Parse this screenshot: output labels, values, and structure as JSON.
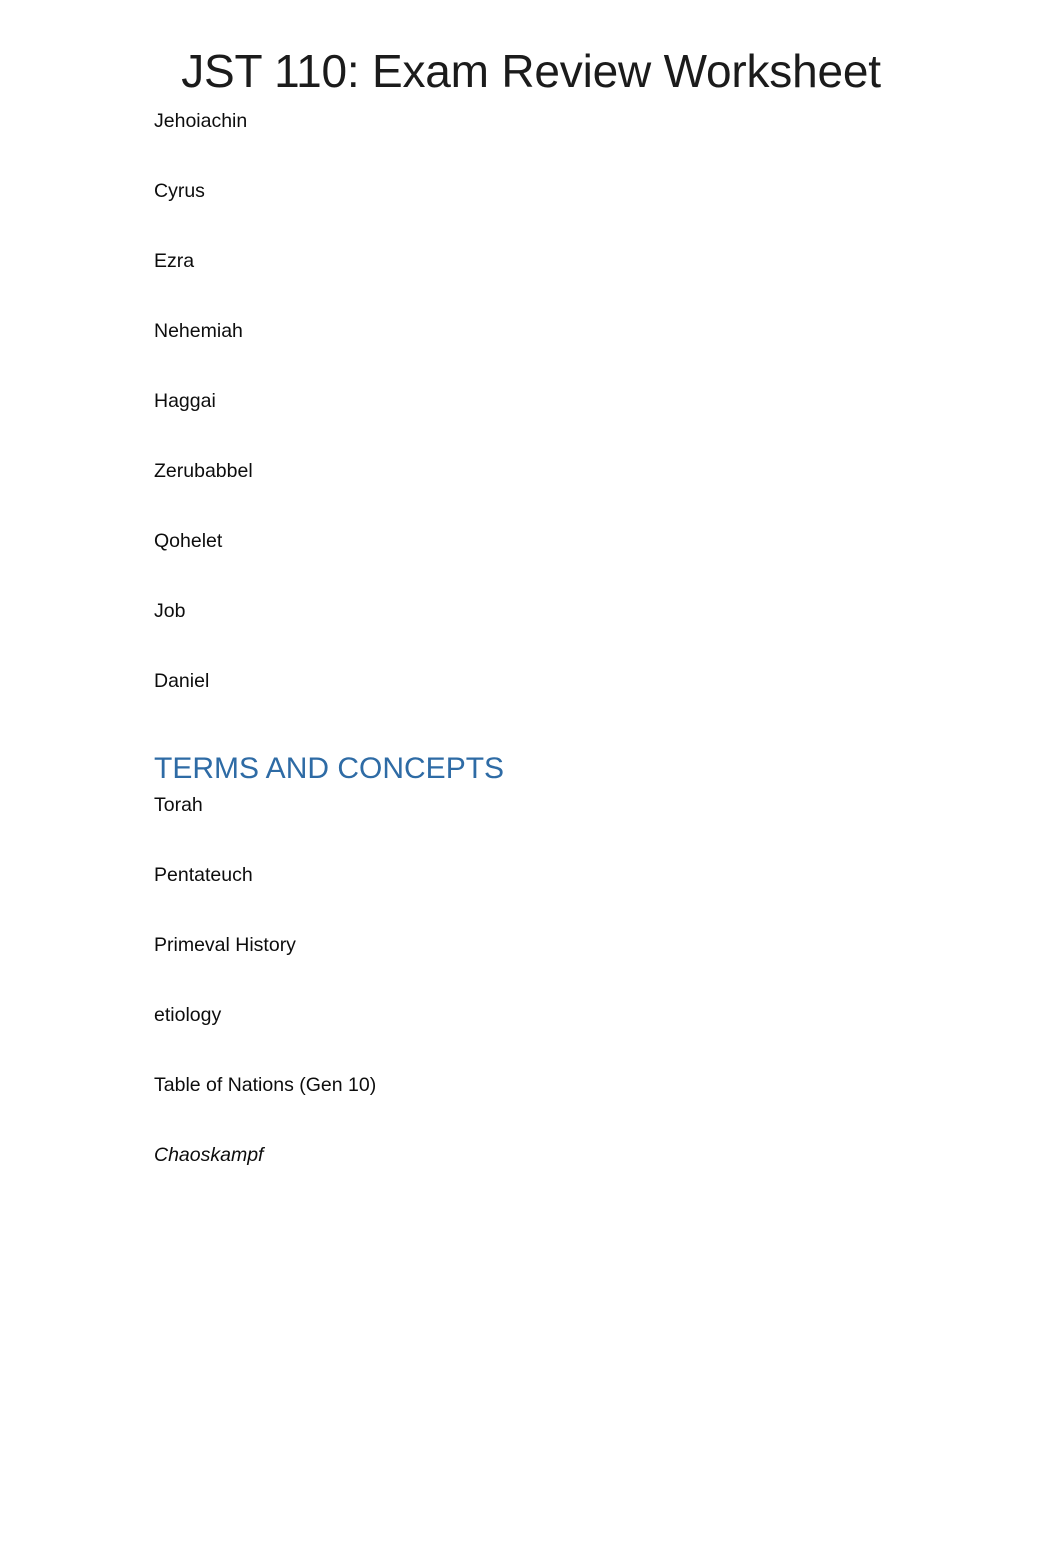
{
  "document": {
    "title": "JST 110: Exam Review Worksheet",
    "title_color": "#1b1b1b",
    "background_color": "#ffffff",
    "body_text_color": "#0d0d0d"
  },
  "people_section": {
    "items": [
      {
        "label": "Jehoiachin",
        "style": "normal"
      },
      {
        "label": "Cyrus",
        "style": "normal"
      },
      {
        "label": "Ezra",
        "style": "normal"
      },
      {
        "label": "Nehemiah",
        "style": "normal"
      },
      {
        "label": "Haggai",
        "style": "normal"
      },
      {
        "label": "Zerubabbel",
        "style": "normal"
      },
      {
        "label": "Qohelet",
        "style": "normal"
      },
      {
        "label": "Job",
        "style": "normal"
      },
      {
        "label": "Daniel",
        "style": "normal"
      }
    ]
  },
  "terms_section": {
    "heading": "TERMS AND CONCEPTS",
    "heading_color": "#2e6ba5",
    "items": [
      {
        "label": "Torah",
        "style": "normal"
      },
      {
        "label": "Pentateuch",
        "style": "normal"
      },
      {
        "label": "Primeval History",
        "style": "normal"
      },
      {
        "label": "etiology",
        "style": "normal"
      },
      {
        "label": "Table of Nations (Gen 10)",
        "style": "normal"
      },
      {
        "label": "Chaoskampf",
        "style": "italic"
      }
    ]
  }
}
